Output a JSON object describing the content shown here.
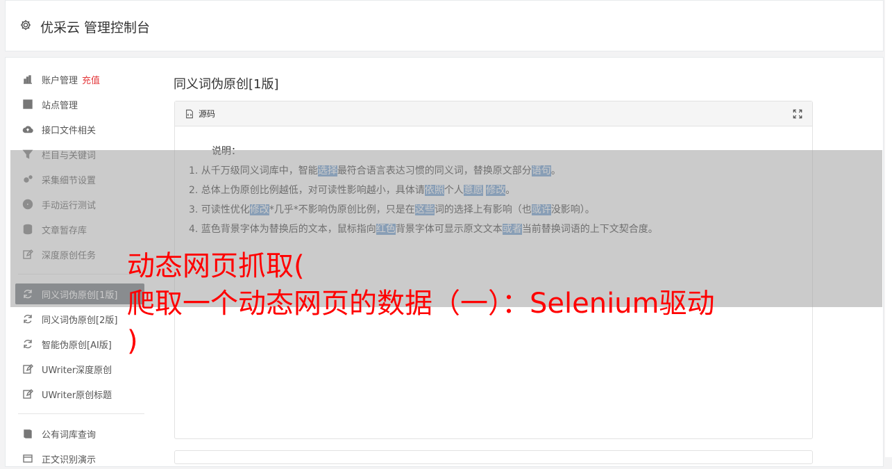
{
  "header": {
    "title": "优采云 管理控制台"
  },
  "sidebar": {
    "items": [
      {
        "label": "账户管理",
        "badge": "充值",
        "icon": "bar-chart-icon"
      },
      {
        "label": "站点管理",
        "icon": "server-icon"
      },
      {
        "label": "接口文件相关",
        "icon": "cloud-upload-icon"
      },
      {
        "label": "栏目与关键词",
        "icon": "filter-icon"
      },
      {
        "label": "采集细节设置",
        "icon": "gears-icon"
      },
      {
        "label": "手动运行测试",
        "icon": "play-circle-icon"
      },
      {
        "label": "文章暂存库",
        "icon": "database-icon"
      },
      {
        "label": "深度原创任务",
        "icon": "edit-icon"
      },
      {
        "label": "同义词伪原创[1版]",
        "icon": "refresh-icon",
        "active": true
      },
      {
        "label": "同义词伪原创[2版]",
        "icon": "refresh-icon"
      },
      {
        "label": "智能伪原创[AI版]",
        "icon": "refresh-icon"
      },
      {
        "label": "UWriter深度原创",
        "icon": "edit-icon"
      },
      {
        "label": "UWriter原创标题",
        "icon": "edit-icon"
      },
      {
        "label": "公有词库查询",
        "icon": "book-icon"
      },
      {
        "label": "正文识别演示",
        "icon": "window-icon"
      }
    ]
  },
  "content": {
    "title": "同义词伪原创[1版]",
    "panel_label": "源码",
    "desc_head": "说明：",
    "lines": [
      [
        {
          "t": "1. 从千万级同义词库中，智能"
        },
        {
          "t": "选择",
          "hl": true
        },
        {
          "t": "最符合语言表达习惯的同义词，替换原文部分"
        },
        {
          "t": "语句",
          "hl": true
        },
        {
          "t": "。"
        }
      ],
      [
        {
          "t": "2. 总体上伪原创比例越低，对可读性影响越小，具体请"
        },
        {
          "t": "依照",
          "hl": true
        },
        {
          "t": "个人"
        },
        {
          "t": "意愿",
          "hl": true
        },
        {
          "t": " "
        },
        {
          "t": "修改",
          "hl": true
        },
        {
          "t": "。"
        }
      ],
      [
        {
          "t": "3. 可读性优化"
        },
        {
          "t": "修改",
          "hl": true
        },
        {
          "t": "*几乎*不影响伪原创比例，只是在"
        },
        {
          "t": "这些",
          "hl": true
        },
        {
          "t": "词的选择上有影响（也"
        },
        {
          "t": "或许",
          "hl": true
        },
        {
          "t": "没影响）。"
        }
      ],
      [
        {
          "t": "4. 蓝色背景字体为替换后的文本，鼠标指向"
        },
        {
          "t": "红色",
          "hl": true
        },
        {
          "t": "背景字体可显示原文文本"
        },
        {
          "t": "或者",
          "hl": true
        },
        {
          "t": "当前替换词语的上下文契合度。"
        }
      ]
    ]
  },
  "overlay": {
    "line1": "动态网页抓取(",
    "line2": "爬取一个动态网页的数据（一）：Selenium驱动",
    "line3": ")"
  }
}
